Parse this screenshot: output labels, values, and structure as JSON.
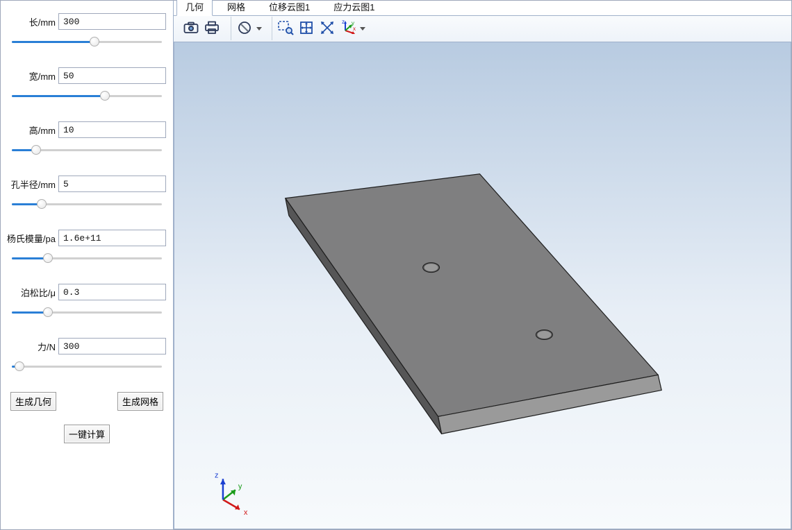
{
  "params": [
    {
      "id": "length",
      "label": "长/mm",
      "value": "300",
      "slider": 55
    },
    {
      "id": "width",
      "label": "宽/mm",
      "value": "50",
      "slider": 62
    },
    {
      "id": "height",
      "label": "高/mm",
      "value": "10",
      "slider": 16
    },
    {
      "id": "radius",
      "label": "孔半径/mm",
      "value": "5",
      "slider": 20
    },
    {
      "id": "young",
      "label": "杨氏模量/pa",
      "value": "1.6e+11",
      "slider": 24
    },
    {
      "id": "poisson",
      "label": "泊松比/μ",
      "value": "0.3",
      "slider": 24
    },
    {
      "id": "force",
      "label": "力/N",
      "value": "300",
      "slider": 5
    }
  ],
  "buttons": {
    "gen_geom": "生成几何",
    "gen_mesh": "生成网格",
    "compute": "一键计算"
  },
  "tabs": [
    {
      "id": "geom",
      "label": "几何",
      "active": true
    },
    {
      "id": "mesh",
      "label": "网格",
      "active": false
    },
    {
      "id": "disp",
      "label": "位移云图1",
      "active": false
    },
    {
      "id": "stress",
      "label": "应力云图1",
      "active": false
    }
  ],
  "toolbar": [
    {
      "id": "snapshot",
      "icon": "camera"
    },
    {
      "id": "print",
      "icon": "printer"
    },
    {
      "id": "sep"
    },
    {
      "id": "filter",
      "icon": "nosign",
      "dropdown": true
    },
    {
      "id": "sep"
    },
    {
      "id": "zoomsel",
      "icon": "zoom-rect"
    },
    {
      "id": "fit",
      "icon": "fit"
    },
    {
      "id": "zoominout",
      "icon": "zoom-arrows"
    },
    {
      "id": "axes",
      "icon": "axes",
      "dropdown": true
    }
  ],
  "axis_labels": {
    "x": "x",
    "y": "y",
    "z": "z"
  }
}
